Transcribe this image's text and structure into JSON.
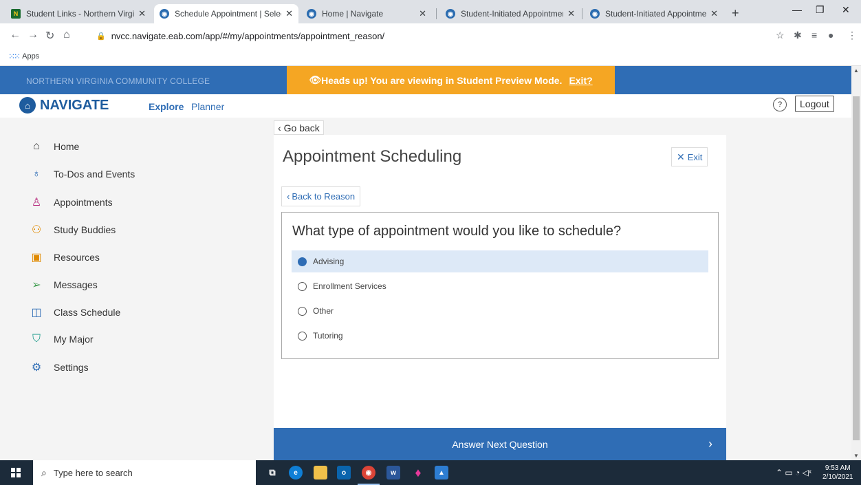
{
  "browser": {
    "tabs": [
      {
        "title": "Student Links - Northern Virgi",
        "favicon": "N"
      },
      {
        "title": "Schedule Appointment | Select",
        "active": true
      },
      {
        "title": "Home | Navigate"
      },
      {
        "title": "Student-Initiated Appointment"
      },
      {
        "title": "Student-Initiated Appointment"
      }
    ],
    "url": "nvcc.navigate.eab.com/app/#/my/appointments/appointment_reason/",
    "bookmarks_apps": "Apps"
  },
  "header": {
    "college": "NORTHERN VIRGINIA COMMUNITY COLLEGE",
    "preview_notice": "Heads up! You are viewing in Student Preview Mode.",
    "preview_exit": "Exit?",
    "logo_text": "NAVIGATE",
    "nav_explore": "Explore",
    "nav_planner": "Planner",
    "help": "?",
    "logout": "Logout"
  },
  "sidebar": {
    "items": [
      {
        "label": "Home",
        "icon": "home-icon"
      },
      {
        "label": "To-Dos and Events",
        "icon": "todo-icon"
      },
      {
        "label": "Appointments",
        "icon": "person-icon"
      },
      {
        "label": "Study Buddies",
        "icon": "people-icon"
      },
      {
        "label": "Resources",
        "icon": "resources-icon"
      },
      {
        "label": "Messages",
        "icon": "paper-plane-icon"
      },
      {
        "label": "Class Schedule",
        "icon": "book-icon"
      },
      {
        "label": "My Major",
        "icon": "graduation-cap-icon"
      },
      {
        "label": "Settings",
        "icon": "gear-icon"
      }
    ]
  },
  "main": {
    "go_back": "Go back",
    "title": "Appointment Scheduling",
    "exit": "Exit",
    "back_to_reason": "Back to Reason",
    "question": "What type of appointment would you like to schedule?",
    "options": [
      {
        "label": "Advising",
        "selected": true
      },
      {
        "label": "Enrollment Services",
        "selected": false
      },
      {
        "label": "Other",
        "selected": false
      },
      {
        "label": "Tutoring",
        "selected": false
      }
    ],
    "next_button": "Answer Next Question"
  },
  "taskbar": {
    "search_placeholder": "Type here to search",
    "time": "9:53 AM",
    "date": "2/10/2021"
  },
  "colors": {
    "brand_blue": "#2f6db5",
    "preview_orange": "#f5a623",
    "selected_bg": "#dde9f7"
  }
}
